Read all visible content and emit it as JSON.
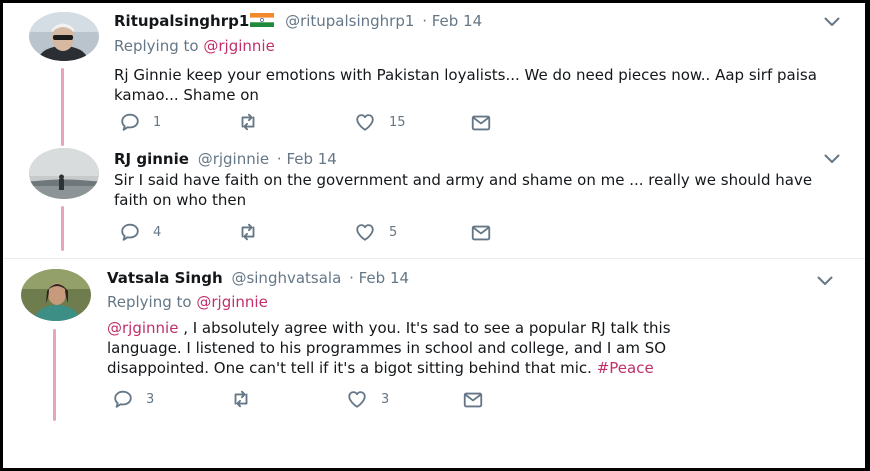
{
  "tweets": [
    {
      "name": "Ritupalsinghrp1",
      "handle": "@ritupalsinghrp1",
      "date": "· Feb 14",
      "replying_label": "Replying to",
      "replying_to": "@rjginnie",
      "text": "Rj Ginnie keep your emotions with Pakistan loyalists... We do need pieces now.. Aap sirf paisa kamao... Shame on",
      "replies": "1",
      "retweets": "",
      "likes": "15"
    },
    {
      "name": "RJ ginnie",
      "handle": "@rjginnie",
      "date": "· Feb 14",
      "text": "Sir I said have faith on the government and army and shame on me ... really we should have faith on who then",
      "replies": "4",
      "retweets": "",
      "likes": "5"
    },
    {
      "name": "Vatsala Singh",
      "handle": "@singhvatsala",
      "date": "· Feb 14",
      "replying_label": "Replying to",
      "replying_to": "@rjginnie",
      "mention": "@rjginnie",
      "text_line1_rest": " , I absolutely agree with you. It's sad to see a popular RJ talk this",
      "text_line2": "language. I listened to his programmes in school and college, and I am SO",
      "text_line3": "disappointed. One can't tell if it's a bigot sitting behind that mic. ",
      "hashtag": "#Peace",
      "replies": "3",
      "retweets": "",
      "likes": "3"
    }
  ],
  "colors": {
    "link": "#c0306a",
    "thread_line": "#e9a4bd",
    "secondary_text": "#657786"
  },
  "icons": [
    "reply-icon",
    "retweet-icon",
    "like-icon",
    "direct-message-icon",
    "chevron-down-icon",
    "india-flag-icon"
  ]
}
